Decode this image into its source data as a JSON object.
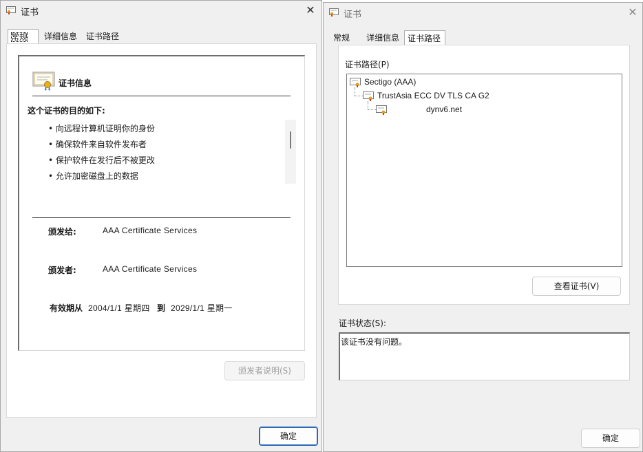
{
  "left_dialog": {
    "title": "证书",
    "tabs": [
      "常规",
      "详细信息",
      "证书路径"
    ],
    "cert_info_heading": "证书信息",
    "purpose_heading": "这个证书的目的如下:",
    "purposes": [
      "• 向远程计算机证明你的身份",
      "• 确保软件来自软件发布者",
      "• 保护软件在发行后不被更改",
      "• 允许加密磁盘上的数据"
    ],
    "issued_to_label": "颁发给:",
    "issued_to_value": "AAA Certificate Services",
    "issued_by_label": "颁发者:",
    "issued_by_value": "AAA Certificate Services",
    "validity_from_label": "有效期从",
    "validity_from_value": "2004/1/1 星期四",
    "validity_to_label": "到",
    "validity_to_value": "2029/1/1 星期一",
    "issuer_statement_button": "颁发者说明(S)",
    "ok_button": "确定"
  },
  "right_dialog": {
    "title": "证书",
    "tabs": [
      "常规",
      "详细信息",
      "证书路径"
    ],
    "cert_path_label": "证书路径(P)",
    "path_nodes": [
      "Sectigo (AAA)",
      "TrustAsia ECC DV TLS CA G2",
      "dynv6.net"
    ],
    "view_cert_button": "查看证书(V)",
    "cert_status_label": "证书状态(S):",
    "cert_status_text": "该证书没有问题。",
    "ok_button": "确定"
  },
  "icons": {
    "title_icon": "certificate-icon",
    "cert_info_icon": "certificate-ribbon-icon",
    "tree_icon": "certificate-icon",
    "close_icon": "close-icon"
  }
}
